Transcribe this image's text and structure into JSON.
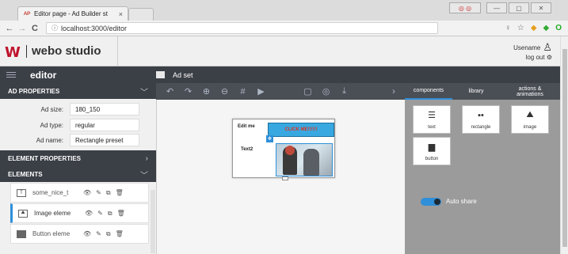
{
  "browser": {
    "tab_title": "Editor page - Ad Builder st",
    "tab_favicon": "AP",
    "tab_close": "×",
    "url": "localhost:3000/editor",
    "nav": {
      "back": "←",
      "forward": "→",
      "reload": "C",
      "info": "ⓘ"
    }
  },
  "app": {
    "logo_mark": "W",
    "logo_text": "webo studio",
    "user": {
      "name": "Usename",
      "logout": "log out ⚙"
    }
  },
  "editor_bar": {
    "title": "editor",
    "adset_label": "Ad set"
  },
  "sections": {
    "ad_properties": "AD PROPERTIES",
    "element_properties": "ELEMENT PROPERTIES",
    "elements": "ELEMENTS"
  },
  "ad_properties": [
    {
      "label": "Ad size:",
      "value": "180_150"
    },
    {
      "label": "Ad type:",
      "value": "regular"
    },
    {
      "label": "Ad name:",
      "value": "Rectangle preset"
    }
  ],
  "elements": [
    {
      "name": "some_nice_t",
      "icon": "T",
      "selected": false
    },
    {
      "name": "Image eleme",
      "icon": "",
      "selected": true
    },
    {
      "name": "Button eleme",
      "icon": "",
      "selected": false
    }
  ],
  "canvas": {
    "text1": "Edit me",
    "button_text": "CLICK ME!!!!!!",
    "text2": "Text2"
  },
  "right_panel": {
    "tabs": [
      "components",
      "library",
      "actions & animations"
    ],
    "components": [
      {
        "label": "text",
        "icon": "text-lines-icon"
      },
      {
        "label": "rectangle",
        "icon": "rectangle-icon"
      },
      {
        "label": "image",
        "icon": "image-icon"
      },
      {
        "label": "button",
        "icon": "button-icon"
      }
    ],
    "auto_share": "Auto share"
  },
  "colors": {
    "accent": "#2f8fd8",
    "dark_bar": "#3b3f46",
    "brand": "#c0122b"
  }
}
